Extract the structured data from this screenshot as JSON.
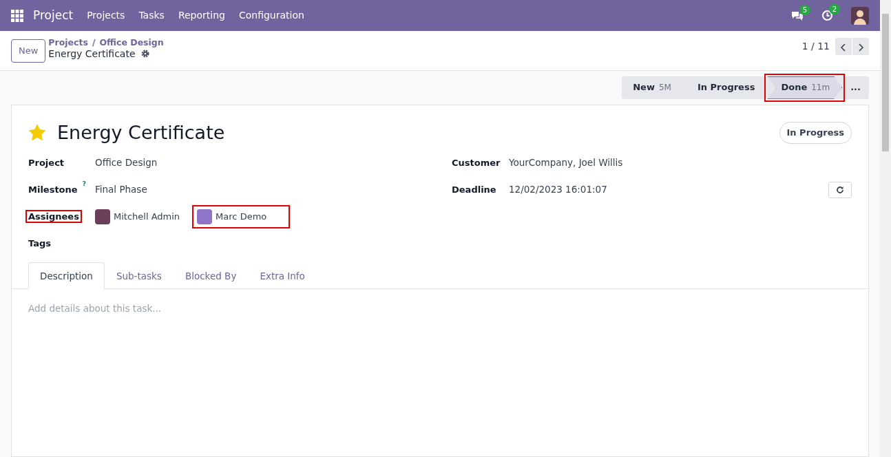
{
  "navbar": {
    "app": "Project",
    "menu": [
      "Projects",
      "Tasks",
      "Reporting",
      "Configuration"
    ],
    "messages_count": "5",
    "activities_count": "2"
  },
  "control_panel": {
    "new_button": "New",
    "breadcrumbs": [
      "Projects",
      "Office Design"
    ],
    "breadcrumb_separator": "/",
    "record": "Energy Certificate",
    "pager": "1 / 11"
  },
  "stages": [
    {
      "label": "New",
      "duration": "5M",
      "selected": false,
      "highlighted": false
    },
    {
      "label": "In Progress",
      "selected": false,
      "highlighted": false
    },
    {
      "label": "Done",
      "duration": "11m",
      "selected": true,
      "highlighted": true
    }
  ],
  "stages_more": "...",
  "form": {
    "starred": true,
    "title": "Energy Certificate",
    "state_button": "In Progress",
    "left_fields": [
      {
        "kind": "text",
        "label": "Project",
        "value": "Office Design",
        "highlighted": false
      },
      {
        "kind": "text",
        "label": "Milestone",
        "help": "?",
        "value": "Final Phase",
        "highlighted": false
      },
      {
        "kind": "users",
        "label": "Assignees",
        "highlighted": true,
        "users": [
          {
            "name": "Mitchell Admin",
            "highlighted": false
          },
          {
            "name": "Marc Demo",
            "highlighted": true
          }
        ]
      },
      {
        "kind": "empty",
        "label": "Tags",
        "highlighted": false
      }
    ],
    "right_fields": [
      {
        "kind": "text",
        "label": "Customer",
        "value": "YourCompany, Joel Willis"
      },
      {
        "kind": "date",
        "label": "Deadline",
        "value": "12/02/2023 16:01:07"
      }
    ],
    "tabs": [
      {
        "label": "Description",
        "selected": true
      },
      {
        "label": "Sub-tasks",
        "selected": false
      },
      {
        "label": "Blocked By",
        "selected": false
      },
      {
        "label": "Extra Info",
        "selected": false
      }
    ],
    "description": {
      "placeholder": "Add details about this task..."
    }
  }
}
